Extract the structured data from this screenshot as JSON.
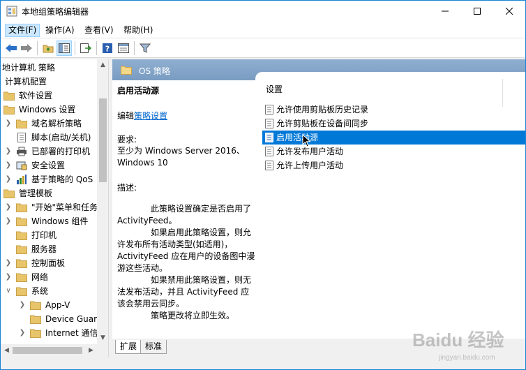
{
  "window": {
    "title": "本地组策略编辑器"
  },
  "menu": {
    "items": [
      {
        "label": "文件(F)"
      },
      {
        "label": "操作(A)"
      },
      {
        "label": "查看(V)"
      },
      {
        "label": "帮助(H)"
      }
    ]
  },
  "toolbar": {
    "buttons": [
      "back-icon",
      "forward-icon",
      "up-folder-icon",
      "show-hide-tree-icon",
      "export-list-icon",
      "help-icon",
      "properties-icon",
      "filter-icon"
    ]
  },
  "tree": {
    "items": [
      {
        "label": "地计算机 策略"
      },
      {
        "label": "计算机配置"
      },
      {
        "label": "软件设置"
      },
      {
        "label": "Windows 设置"
      },
      {
        "label": "域名解析策略"
      },
      {
        "label": "脚本(启动/关机)"
      },
      {
        "label": "已部署的打印机"
      },
      {
        "label": "安全设置"
      },
      {
        "label": "基于策略的 QoS"
      },
      {
        "label": "管理模板"
      },
      {
        "label": "\"开始\"菜单和任务"
      },
      {
        "label": "Windows 组件"
      },
      {
        "label": "打印机"
      },
      {
        "label": "服务器"
      },
      {
        "label": "控制面板"
      },
      {
        "label": "网络"
      },
      {
        "label": "系统"
      },
      {
        "label": "App-V"
      },
      {
        "label": "Device Guard"
      },
      {
        "label": "Internet 通信"
      }
    ]
  },
  "header": {
    "title": "OS 策略"
  },
  "description": {
    "title": "启用活动源",
    "edit_prefix": "编辑",
    "edit_link": "策略设置",
    "requirements_label": "要求:",
    "requirements": "至少为 Windows Server 2016、Windows 10",
    "description_label": "描述:",
    "paragraphs": [
      "此策略设置确定是否启用了 ActivityFeed。",
      "如果启用此策略设置，则允许发布所有活动类型(如适用)，ActivityFeed 应在用户的设备图中漫游这些活动。",
      "如果禁用此策略设置，则无法发布活动，并且 ActivityFeed 应该会禁用云同步。",
      "策略更改将立即生效。"
    ]
  },
  "settings": {
    "header": "设置",
    "items": [
      {
        "label": "允许使用剪贴板历史记录"
      },
      {
        "label": "允许剪贴板在设备间同步"
      },
      {
        "label": "启用活动源"
      },
      {
        "label": "允许发布用户活动"
      },
      {
        "label": "允许上传用户活动"
      }
    ],
    "selected_index": 2
  },
  "tabs": [
    {
      "label": "扩展"
    },
    {
      "label": "标准"
    }
  ],
  "watermark": {
    "main": "Baidu 经验",
    "sub": "jingyan.baidu.com"
  },
  "colors": {
    "selection": "#0078d7",
    "header_bar": "#7a9cc2",
    "link": "#0066cc",
    "folder": "#e8c46a"
  }
}
